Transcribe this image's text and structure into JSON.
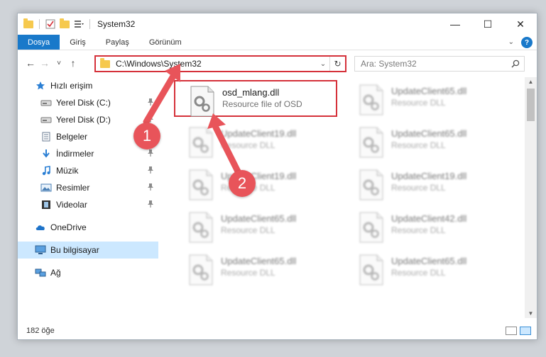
{
  "window": {
    "title": "System32",
    "controls": {
      "minimize": "—",
      "maximize": "☐",
      "close": "✕"
    }
  },
  "ribbon": {
    "tabs": [
      "Dosya",
      "Giriş",
      "Paylaş",
      "Görünüm"
    ],
    "help": "?"
  },
  "nav": {
    "back": "←",
    "forward": "→",
    "recent": "˅",
    "up": "↑",
    "address": "C:\\Windows\\System32",
    "search_placeholder": "Ara: System32"
  },
  "sidebar": {
    "items": [
      {
        "label": "Hızlı erişim",
        "icon": "star-icon",
        "level": 1,
        "pinned": false
      },
      {
        "label": "Yerel Disk (C:)",
        "icon": "drive-icon",
        "level": 2,
        "pinned": true
      },
      {
        "label": "Yerel Disk (D:)",
        "icon": "drive-icon",
        "level": 2,
        "pinned": true
      },
      {
        "label": "Belgeler",
        "icon": "documents-icon",
        "level": 2,
        "pinned": true
      },
      {
        "label": "İndirmeler",
        "icon": "download-icon",
        "level": 2,
        "pinned": true
      },
      {
        "label": "Müzik",
        "icon": "music-icon",
        "level": 2,
        "pinned": true
      },
      {
        "label": "Resimler",
        "icon": "pictures-icon",
        "level": 2,
        "pinned": true
      },
      {
        "label": "Videolar",
        "icon": "video-icon",
        "level": 2,
        "pinned": true
      },
      {
        "label": "OneDrive",
        "icon": "cloud-icon",
        "level": 1,
        "pinned": false
      },
      {
        "label": "Bu bilgisayar",
        "icon": "computer-icon",
        "level": 1,
        "pinned": false,
        "active": true
      },
      {
        "label": "Ağ",
        "icon": "network-icon",
        "level": 1,
        "pinned": false
      }
    ]
  },
  "files": [
    {
      "name": "osd_mlang.dll",
      "desc": "Resource file of OSD",
      "selected": true
    },
    {
      "name": "UpdateClient65.dll",
      "desc": "Resource DLL"
    },
    {
      "name": "UpdateClient19.dll",
      "desc": "Resource DLL"
    },
    {
      "name": "UpdateClient65.dll",
      "desc": "Resource DLL"
    },
    {
      "name": "UpdateClient19.dll",
      "desc": "Resource DLL"
    },
    {
      "name": "UpdateClient19.dll",
      "desc": "Resource DLL"
    },
    {
      "name": "UpdateClient65.dll",
      "desc": "Resource DLL"
    },
    {
      "name": "UpdateClient42.dll",
      "desc": "Resource DLL"
    },
    {
      "name": "UpdateClient65.dll",
      "desc": "Resource DLL"
    },
    {
      "name": "UpdateClient65.dll",
      "desc": "Resource DLL"
    }
  ],
  "status": {
    "count": "182 öğe"
  },
  "annotations": {
    "step1": "1",
    "step2": "2"
  },
  "colors": {
    "accent": "#1979ca",
    "highlight": "#d5313a",
    "badge": "#e8545a",
    "selected": "#cce8ff"
  }
}
